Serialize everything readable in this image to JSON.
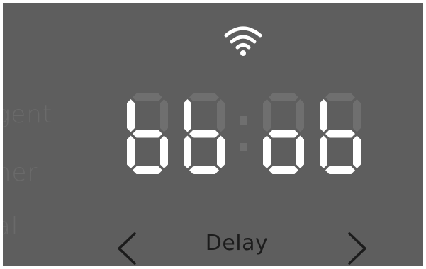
{
  "background_labels": [
    "gent",
    "ner",
    "al"
  ],
  "wifi_icon": "wifi-icon",
  "display": {
    "digits": [
      "b",
      "b",
      "o",
      "b"
    ],
    "colon": true,
    "lit_color": "#ffffff",
    "unlit_color": "#6f6f6f"
  },
  "mode_selector": {
    "label": "Delay",
    "prev_icon": "chevron-left-icon",
    "next_icon": "chevron-right-icon"
  }
}
